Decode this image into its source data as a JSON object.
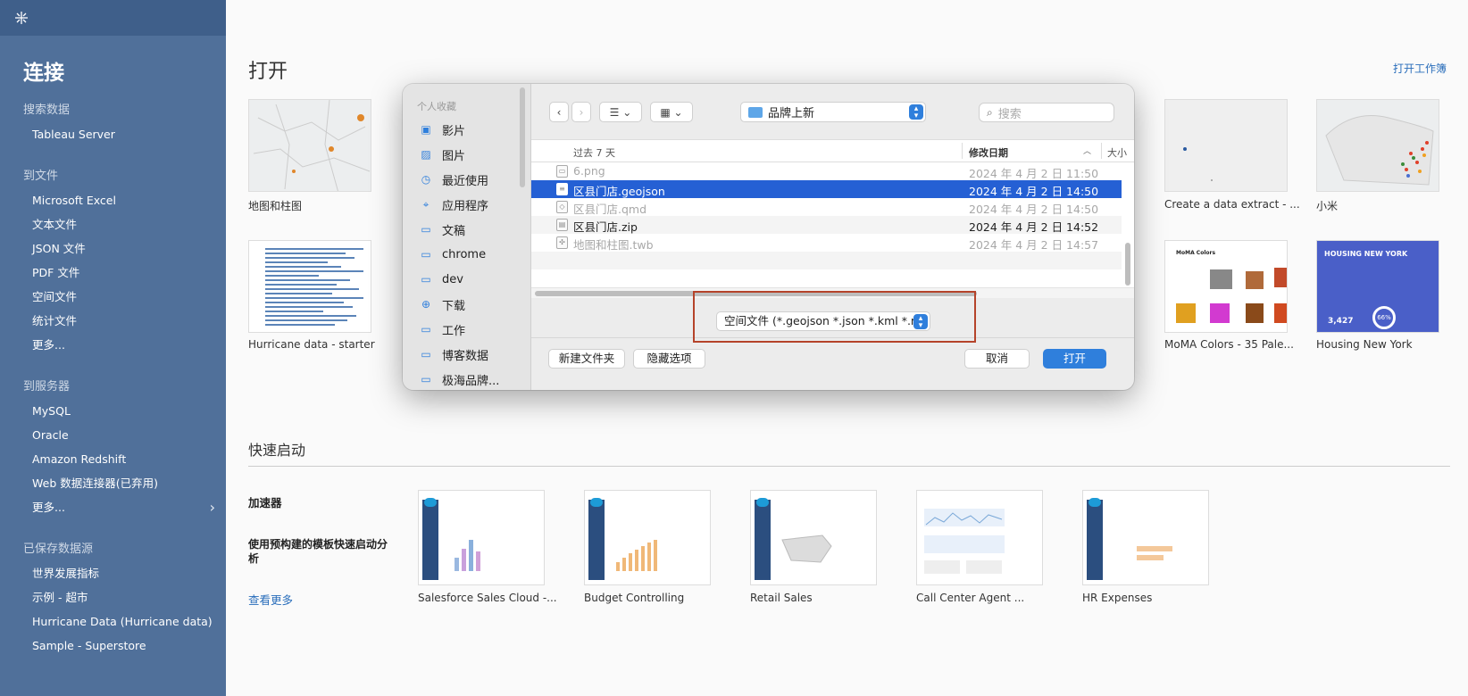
{
  "sidebar": {
    "title": "连接",
    "sections": [
      {
        "header": "搜索数据",
        "items": [
          "Tableau Server"
        ]
      },
      {
        "header": "到文件",
        "items": [
          "Microsoft Excel",
          "文本文件",
          "JSON 文件",
          "PDF 文件",
          "空间文件",
          "统计文件",
          "更多..."
        ]
      },
      {
        "header": "到服务器",
        "items": [
          "MySQL",
          "Oracle",
          "Amazon Redshift",
          "Web 数据连接器(已弃用)",
          "更多..."
        ]
      },
      {
        "header": "已保存数据源",
        "items": [
          "世界发展指标",
          "示例 - 超市",
          "Hurricane Data (Hurricane data)",
          "Sample - Superstore"
        ]
      }
    ]
  },
  "main": {
    "title": "打开",
    "open_workbook": "打开工作簿",
    "recent": [
      {
        "label": "地图和柱图"
      },
      {
        "label": "Hurricane data - starter"
      },
      {
        "label": "Create a data extract - ..."
      },
      {
        "label": "小米"
      },
      {
        "label": "MoMA Colors - 35 Pale..."
      },
      {
        "label": "Housing New York"
      }
    ],
    "thumb_text": {
      "moma_title": "MoMA Colors",
      "housing_title": "HOUSING NEW YORK",
      "housing_stat": "3,427",
      "housing_pct": "66%"
    },
    "quick_start": {
      "title": "快速启动",
      "accelerator": "加速器",
      "description": "使用预构建的模板快速启动分析",
      "see_more": "查看更多",
      "items": [
        "Salesforce Sales Cloud -...",
        "Budget Controlling",
        "Retail Sales",
        "Call Center Agent ...",
        "HR Expenses"
      ]
    }
  },
  "dialog": {
    "favorites_header": "个人收藏",
    "favorites": [
      {
        "label": "影片",
        "icon": "film-icon"
      },
      {
        "label": "图片",
        "icon": "photo-icon"
      },
      {
        "label": "最近使用",
        "icon": "clock-icon"
      },
      {
        "label": "应用程序",
        "icon": "apps-icon"
      },
      {
        "label": "文稿",
        "icon": "document-icon"
      },
      {
        "label": "chrome",
        "icon": "folder-icon"
      },
      {
        "label": "dev",
        "icon": "folder-icon"
      },
      {
        "label": "下载",
        "icon": "download-icon"
      },
      {
        "label": "工作",
        "icon": "folder-icon"
      },
      {
        "label": "博客数据",
        "icon": "folder-icon"
      },
      {
        "label": "极海品牌...",
        "icon": "folder-icon"
      }
    ],
    "current_folder": "品牌上新",
    "search_placeholder": "搜索",
    "columns": {
      "name": "过去 7 天",
      "date": "修改日期",
      "size": "大小"
    },
    "files": [
      {
        "name": "6.png",
        "date": "2024 年 4 月 2 日 11:50",
        "state": "dim"
      },
      {
        "name": "区县门店.geojson",
        "date": "2024 年 4 月 2 日 14:50",
        "state": "selected"
      },
      {
        "name": "区县门店.qmd",
        "date": "2024 年 4 月 2 日 14:50",
        "state": "dim"
      },
      {
        "name": "区县门店.zip",
        "date": "2024 年 4 月 2 日 14:52",
        "state": "normal"
      },
      {
        "name": "地图和柱图.twb",
        "date": "2024 年 4 月 2 日 14:57",
        "state": "dim"
      }
    ],
    "file_type_filter": "空间文件 (*.geojson *.json *.kml *.m...",
    "buttons": {
      "new_folder": "新建文件夹",
      "hide_options": "隐藏选项",
      "cancel": "取消",
      "open": "打开"
    }
  },
  "colors": {
    "sidebar": "#50709a",
    "accent": "#2f7fdc",
    "selection": "#2560d4",
    "highlight": "#b5432a"
  }
}
